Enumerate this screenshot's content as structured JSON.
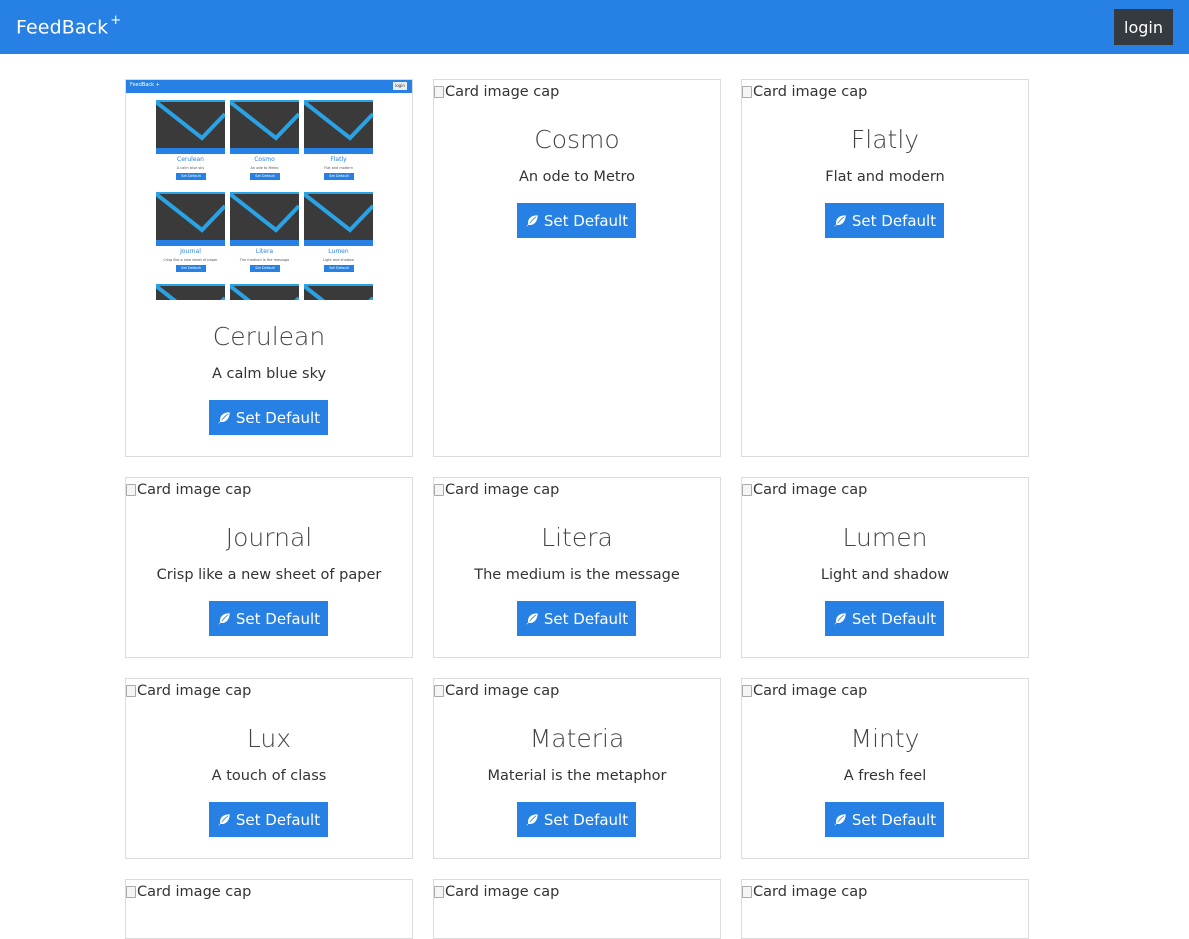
{
  "navbar": {
    "brand": "FeedBack",
    "brand_sup": "+",
    "login_label": "login"
  },
  "image_alt": "Card image cap",
  "button_label": "Set Default",
  "themes": [
    {
      "name": "Cerulean",
      "description": "A calm blue sky"
    },
    {
      "name": "Cosmo",
      "description": "An ode to Metro"
    },
    {
      "name": "Flatly",
      "description": "Flat and modern"
    },
    {
      "name": "Journal",
      "description": "Crisp like a new sheet of paper"
    },
    {
      "name": "Litera",
      "description": "The medium is the message"
    },
    {
      "name": "Lumen",
      "description": "Light and shadow"
    },
    {
      "name": "Lux",
      "description": "A touch of class"
    },
    {
      "name": "Materia",
      "description": "Material is the metaphor"
    },
    {
      "name": "Minty",
      "description": "A fresh feel"
    }
  ],
  "preview": {
    "brand": "FeedBack +",
    "login": "login",
    "button": "Set Default",
    "cards": [
      {
        "name": "Cerulean",
        "description": "A calm blue sky"
      },
      {
        "name": "Cosmo",
        "description": "An ode to Metro"
      },
      {
        "name": "Flatly",
        "description": "Flat and modern"
      },
      {
        "name": "Journal",
        "description": "Crisp like a new sheet of paper"
      },
      {
        "name": "Litera",
        "description": "The medium is the message"
      },
      {
        "name": "Lumen",
        "description": "Light and shadow"
      }
    ]
  },
  "colors": {
    "primary": "#2780e3",
    "dark": "#343a40",
    "border": "#dcdcdc"
  },
  "icons": {
    "button_icon": "leaf-icon",
    "broken_image_icon": "broken-image-icon"
  }
}
